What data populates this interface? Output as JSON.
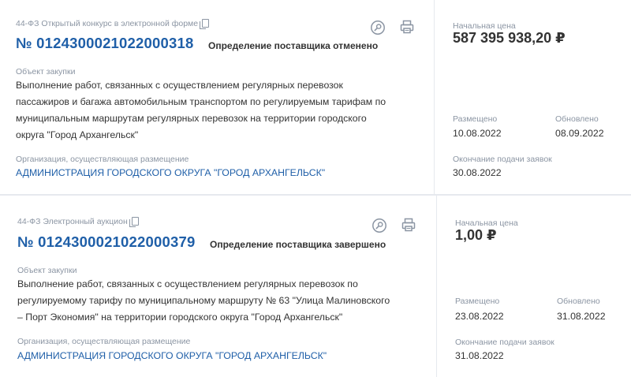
{
  "records": [
    {
      "law_type": "44-ФЗ Открытый конкурс в электронной форме",
      "number": "№ 0124300021022000318",
      "status": "Определение поставщика отменено",
      "object_label": "Объект закупки",
      "object_lines": [
        "Выполнение работ, связанных с осуществлением регулярных перевозок",
        "пассажиров и багажа автомобильным транспортом по регулируемым тарифам по",
        "муниципальным маршрутам регулярных перевозок на территории городского",
        "округа \"Город Архангельск\""
      ],
      "org_label": "Организация, осуществляющая размещение",
      "org_name": "АДМИНИСТРАЦИЯ ГОРОДСКОГО ОКРУГА \"ГОРОД АРХАНГЕЛЬСК\"",
      "price_label": "Начальная цена",
      "price": "587 395 938,20 ₽",
      "placed_label": "Размещено",
      "placed_date": "10.08.2022",
      "updated_label": "Обновлено",
      "updated_date": "08.09.2022",
      "deadline_label": "Окончание подачи заявок",
      "deadline_date": "30.08.2022"
    },
    {
      "law_type": "44-ФЗ Электронный аукцион",
      "number": "№ 0124300021022000379",
      "status": "Определение поставщика завершено",
      "object_label": "Объект закупки",
      "object_lines": [
        "Выполнение работ, связанных с осуществлением регулярных перевозок по",
        "регулируемому тарифу по муниципальному маршруту № 63 \"Улица Малиновского",
        "– Порт Экономия\" на территории городского округа \"Город Архангельск\""
      ],
      "org_label": "Организация, осуществляющая размещение",
      "org_name": "АДМИНИСТРАЦИЯ ГОРОДСКОГО ОКРУГА \"ГОРОД АРХАНГЕЛЬСК\"",
      "price_label": "Начальная цена",
      "price": "1,00 ₽",
      "placed_label": "Размещено",
      "placed_date": "23.08.2022",
      "updated_label": "Обновлено",
      "updated_date": "31.08.2022",
      "deadline_label": "Окончание подачи заявок",
      "deadline_date": "31.08.2022"
    }
  ],
  "icons": {
    "search": "search-icon",
    "print": "printer-icon",
    "copy": "copy-icon"
  },
  "colors": {
    "link": "#1f5fa8",
    "muted": "#8b95a3",
    "text": "#333333",
    "divider": "#e6e9ee"
  }
}
